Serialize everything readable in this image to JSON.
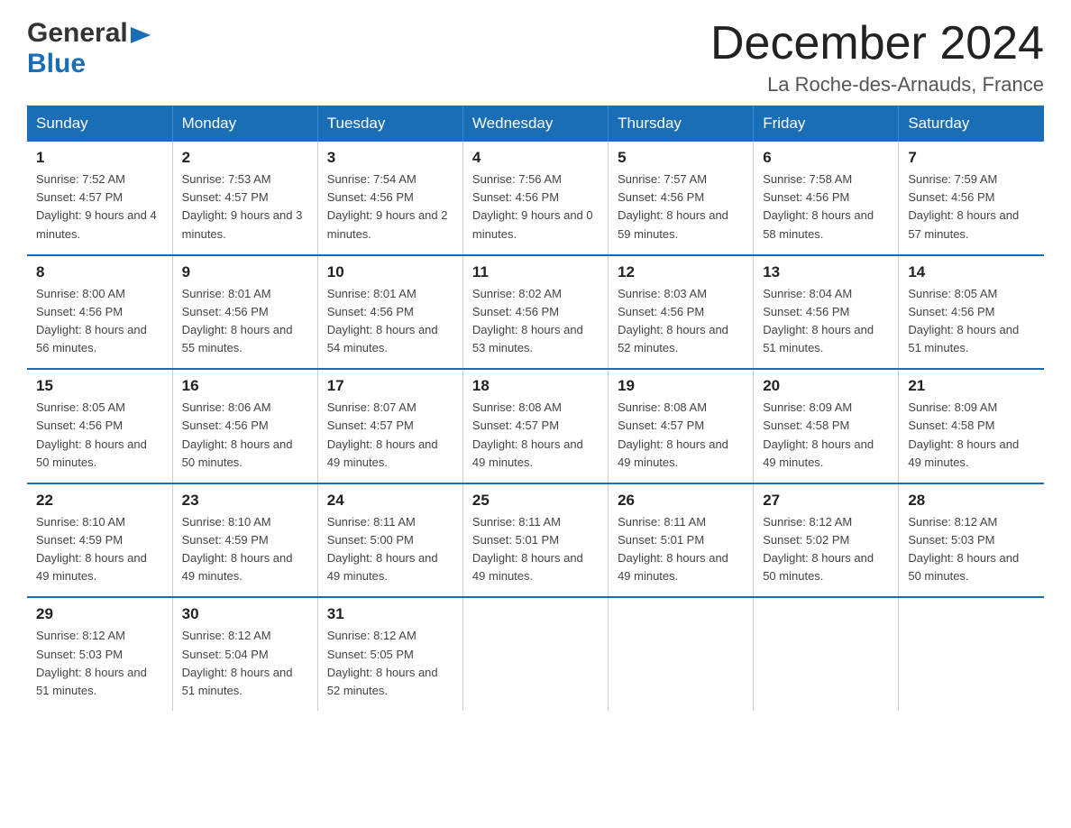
{
  "logo": {
    "line1": "General",
    "arrow": "▶",
    "line2": "Blue"
  },
  "title": "December 2024",
  "location": "La Roche-des-Arnauds, France",
  "days_of_week": [
    "Sunday",
    "Monday",
    "Tuesday",
    "Wednesday",
    "Thursday",
    "Friday",
    "Saturday"
  ],
  "weeks": [
    [
      {
        "day": "1",
        "sunrise": "7:52 AM",
        "sunset": "4:57 PM",
        "daylight": "9 hours and 4 minutes."
      },
      {
        "day": "2",
        "sunrise": "7:53 AM",
        "sunset": "4:57 PM",
        "daylight": "9 hours and 3 minutes."
      },
      {
        "day": "3",
        "sunrise": "7:54 AM",
        "sunset": "4:56 PM",
        "daylight": "9 hours and 2 minutes."
      },
      {
        "day": "4",
        "sunrise": "7:56 AM",
        "sunset": "4:56 PM",
        "daylight": "9 hours and 0 minutes."
      },
      {
        "day": "5",
        "sunrise": "7:57 AM",
        "sunset": "4:56 PM",
        "daylight": "8 hours and 59 minutes."
      },
      {
        "day": "6",
        "sunrise": "7:58 AM",
        "sunset": "4:56 PM",
        "daylight": "8 hours and 58 minutes."
      },
      {
        "day": "7",
        "sunrise": "7:59 AM",
        "sunset": "4:56 PM",
        "daylight": "8 hours and 57 minutes."
      }
    ],
    [
      {
        "day": "8",
        "sunrise": "8:00 AM",
        "sunset": "4:56 PM",
        "daylight": "8 hours and 56 minutes."
      },
      {
        "day": "9",
        "sunrise": "8:01 AM",
        "sunset": "4:56 PM",
        "daylight": "8 hours and 55 minutes."
      },
      {
        "day": "10",
        "sunrise": "8:01 AM",
        "sunset": "4:56 PM",
        "daylight": "8 hours and 54 minutes."
      },
      {
        "day": "11",
        "sunrise": "8:02 AM",
        "sunset": "4:56 PM",
        "daylight": "8 hours and 53 minutes."
      },
      {
        "day": "12",
        "sunrise": "8:03 AM",
        "sunset": "4:56 PM",
        "daylight": "8 hours and 52 minutes."
      },
      {
        "day": "13",
        "sunrise": "8:04 AM",
        "sunset": "4:56 PM",
        "daylight": "8 hours and 51 minutes."
      },
      {
        "day": "14",
        "sunrise": "8:05 AM",
        "sunset": "4:56 PM",
        "daylight": "8 hours and 51 minutes."
      }
    ],
    [
      {
        "day": "15",
        "sunrise": "8:05 AM",
        "sunset": "4:56 PM",
        "daylight": "8 hours and 50 minutes."
      },
      {
        "day": "16",
        "sunrise": "8:06 AM",
        "sunset": "4:56 PM",
        "daylight": "8 hours and 50 minutes."
      },
      {
        "day": "17",
        "sunrise": "8:07 AM",
        "sunset": "4:57 PM",
        "daylight": "8 hours and 49 minutes."
      },
      {
        "day": "18",
        "sunrise": "8:08 AM",
        "sunset": "4:57 PM",
        "daylight": "8 hours and 49 minutes."
      },
      {
        "day": "19",
        "sunrise": "8:08 AM",
        "sunset": "4:57 PM",
        "daylight": "8 hours and 49 minutes."
      },
      {
        "day": "20",
        "sunrise": "8:09 AM",
        "sunset": "4:58 PM",
        "daylight": "8 hours and 49 minutes."
      },
      {
        "day": "21",
        "sunrise": "8:09 AM",
        "sunset": "4:58 PM",
        "daylight": "8 hours and 49 minutes."
      }
    ],
    [
      {
        "day": "22",
        "sunrise": "8:10 AM",
        "sunset": "4:59 PM",
        "daylight": "8 hours and 49 minutes."
      },
      {
        "day": "23",
        "sunrise": "8:10 AM",
        "sunset": "4:59 PM",
        "daylight": "8 hours and 49 minutes."
      },
      {
        "day": "24",
        "sunrise": "8:11 AM",
        "sunset": "5:00 PM",
        "daylight": "8 hours and 49 minutes."
      },
      {
        "day": "25",
        "sunrise": "8:11 AM",
        "sunset": "5:01 PM",
        "daylight": "8 hours and 49 minutes."
      },
      {
        "day": "26",
        "sunrise": "8:11 AM",
        "sunset": "5:01 PM",
        "daylight": "8 hours and 49 minutes."
      },
      {
        "day": "27",
        "sunrise": "8:12 AM",
        "sunset": "5:02 PM",
        "daylight": "8 hours and 50 minutes."
      },
      {
        "day": "28",
        "sunrise": "8:12 AM",
        "sunset": "5:03 PM",
        "daylight": "8 hours and 50 minutes."
      }
    ],
    [
      {
        "day": "29",
        "sunrise": "8:12 AM",
        "sunset": "5:03 PM",
        "daylight": "8 hours and 51 minutes."
      },
      {
        "day": "30",
        "sunrise": "8:12 AM",
        "sunset": "5:04 PM",
        "daylight": "8 hours and 51 minutes."
      },
      {
        "day": "31",
        "sunrise": "8:12 AM",
        "sunset": "5:05 PM",
        "daylight": "8 hours and 52 minutes."
      },
      null,
      null,
      null,
      null
    ]
  ]
}
